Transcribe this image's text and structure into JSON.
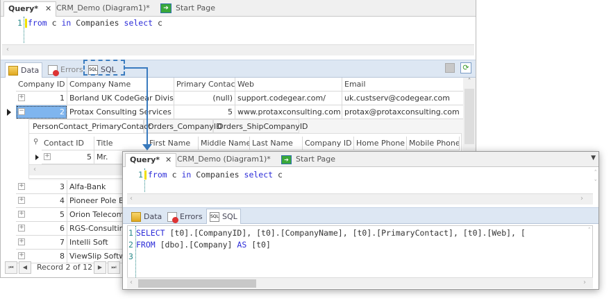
{
  "back": {
    "tabs": [
      {
        "label": "Query*",
        "close": "✕"
      },
      {
        "label": "CRM_Demo (Diagram1)*"
      },
      {
        "label": "Start Page"
      }
    ],
    "editor": {
      "line": "1",
      "code": [
        {
          "t": "from",
          "k": true
        },
        {
          "t": " c ",
          "k": false
        },
        {
          "t": "in",
          "k": true
        },
        {
          "t": " Companies ",
          "k": false
        },
        {
          "t": "select",
          "k": true
        },
        {
          "t": " c",
          "k": false
        }
      ]
    },
    "result_tabs": [
      "Data",
      "Errors",
      "SQL"
    ],
    "grid": {
      "headers": [
        "Company ID",
        "Company Name",
        "Primary Contact",
        "Web",
        "Email"
      ],
      "rows": [
        [
          "1",
          "Borland UK CodeGear Division",
          "(null)",
          "support.codegear.com/",
          "uk.custserv@codegear.com"
        ],
        [
          "2",
          "Protax Consulting Services",
          "5",
          "www.protaxconsulting.com",
          "protax@protaxconsulting.com"
        ]
      ],
      "detail_tabs": [
        "PersonContact_PrimaryContact",
        "Orders_CompanyID",
        "Orders_ShipCompanyID"
      ],
      "detail_headers": [
        "Contact ID",
        "Title",
        "First Name",
        "Middle Name",
        "Last Name",
        "Company ID",
        "Home Phone",
        "Mobile Phone"
      ],
      "detail_row": [
        "5",
        "Mr."
      ],
      "more_rows": [
        [
          "3",
          "Alfa-Bank"
        ],
        [
          "4",
          "Pioneer Pole Buildings"
        ],
        [
          "5",
          "Orion Telecoms"
        ],
        [
          "6",
          "RGS-Consulting"
        ],
        [
          "7",
          "Intelli Soft"
        ],
        [
          "8",
          "ViewSlip Software"
        ]
      ],
      "navigator": "Record 2 of 12"
    }
  },
  "front": {
    "tabs": [
      {
        "label": "Query*",
        "close": "✕"
      },
      {
        "label": "CRM_Demo (Diagram1)*"
      },
      {
        "label": "Start Page"
      }
    ],
    "editor": {
      "line": "1"
    },
    "result_tabs": [
      "Data",
      "Errors",
      "SQL"
    ],
    "sql": {
      "lines": [
        "1",
        "2",
        "3"
      ],
      "line1": [
        {
          "t": "SELECT",
          "k": true
        },
        {
          "t": " [t0].[CompanyID], [t0].[CompanyName], [t0].[PrimaryContact], [t0].[Web], [",
          "k": false
        }
      ],
      "line2": [
        {
          "t": "FROM",
          "k": true
        },
        {
          "t": " [dbo].[Company] ",
          "k": false
        },
        {
          "t": "AS",
          "k": true
        },
        {
          "t": " [t0]",
          "k": false
        }
      ]
    }
  },
  "colors": {
    "accent": "#3a7bbf",
    "keyword": "#2b2bd8",
    "selection": "#7fb5ee"
  }
}
